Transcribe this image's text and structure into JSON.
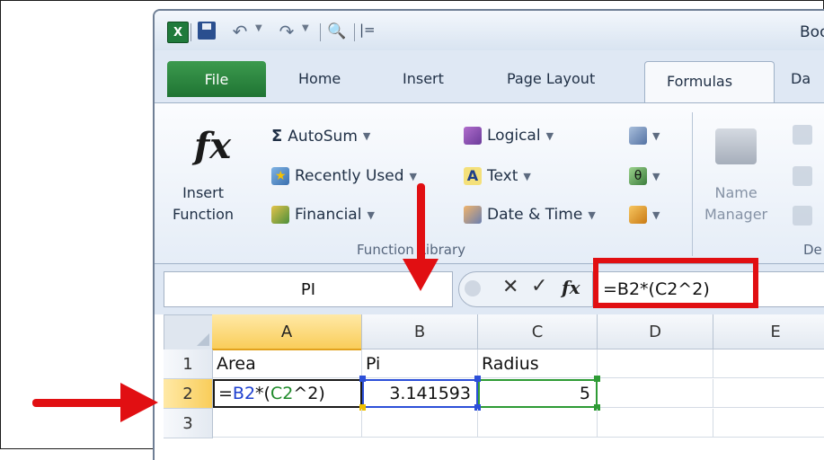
{
  "window": {
    "title": "Boo",
    "app_icon": "X"
  },
  "quick_access": {
    "icons": [
      "excel-logo-icon",
      "save-icon",
      "undo-icon",
      "redo-icon",
      "print-preview-icon",
      "customize-icon"
    ],
    "customize_glyph": "|="
  },
  "tabs": [
    {
      "label": "File"
    },
    {
      "label": "Home"
    },
    {
      "label": "Insert"
    },
    {
      "label": "Page Layout"
    },
    {
      "label": "Formulas"
    },
    {
      "label": "Da"
    }
  ],
  "ribbon": {
    "insert_function": {
      "glyph": "fx",
      "line1": "Insert",
      "line2": "Function"
    },
    "function_library": {
      "autosum": "AutoSum",
      "recently_used": "Recently Used",
      "financial": "Financial",
      "logical": "Logical",
      "text": "Text",
      "date_time": "Date & Time",
      "group_label": "Function Library"
    },
    "name_manager": {
      "line1": "Name",
      "line2": "Manager"
    },
    "defined_names_label": "De",
    "sigma": "Σ",
    "text_glyph": "A",
    "math_glyph": "θ"
  },
  "formula_bar": {
    "name_box": "PI",
    "cancel": "✕",
    "enter": "✓",
    "fx": "fx",
    "formula": "=B2*(C2^2)"
  },
  "sheet": {
    "columns": [
      "A",
      "B",
      "C",
      "D",
      "E"
    ],
    "rows": [
      "1",
      "2",
      "3"
    ],
    "cells": {
      "A1": "Area",
      "B1": "Pi",
      "C1": "Radius",
      "A2_parts": [
        "=",
        "B2",
        "*(",
        "C2",
        "^2)"
      ],
      "B2": "3.141593",
      "C2": "5"
    }
  },
  "colors": {
    "annotation_red": "#e10f12",
    "file_tab_green": "#2a8a3f",
    "ref_blue": "#1d3fcf",
    "ref_green": "#1e8a2a",
    "selected_header": "#f9cd5a"
  }
}
